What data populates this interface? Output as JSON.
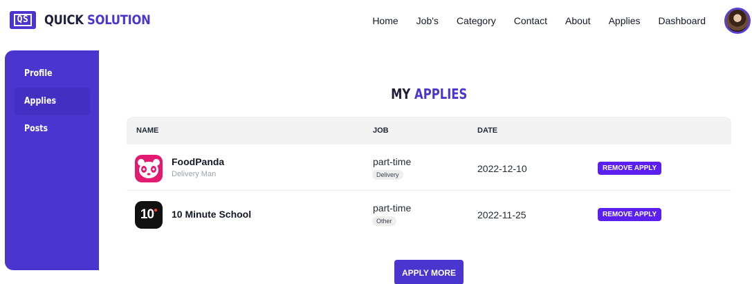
{
  "brand": {
    "logo_mark": "QS",
    "name_part1": "QUICK",
    "name_part2": "SOLUTION"
  },
  "nav": {
    "items": [
      "Home",
      "Job's",
      "Category",
      "Contact",
      "About",
      "Applies",
      "Dashboard"
    ]
  },
  "sidebar": {
    "items": [
      {
        "label": "Profile",
        "active": false
      },
      {
        "label": "Applies",
        "active": true
      },
      {
        "label": "Posts",
        "active": false
      }
    ]
  },
  "main": {
    "title_part1": "MY",
    "title_part2": "APPLIES",
    "table": {
      "headers": {
        "name": "NAME",
        "job": "JOB",
        "date": "DATE"
      },
      "rows": [
        {
          "company": "FoodPanda",
          "position": "Delivery Man",
          "job_type": "part-time",
          "category": "Delivery",
          "date": "2022-12-10",
          "action": "REMOVE APPLY",
          "logo_icon": "foodpanda-logo"
        },
        {
          "company": "10 Minute School",
          "position": "",
          "job_type": "part-time",
          "category": "Other",
          "date": "2022-11-25",
          "action": "REMOVE APPLY",
          "logo_icon": "10-minute-school-logo",
          "logo_text": "10"
        }
      ]
    },
    "apply_more_label": "APPLY MORE"
  },
  "colors": {
    "brand": "#4a35cf",
    "button": "#5b1ff0",
    "foodpanda": "#e21b70"
  }
}
